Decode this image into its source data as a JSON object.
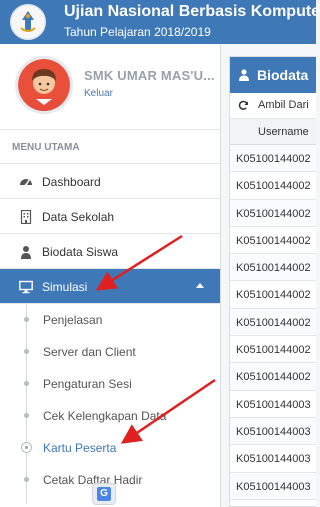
{
  "header": {
    "title": "Ujian Nasional Berbasis Komputer",
    "subtitle": "Tahun Pelajaran 2018/2019"
  },
  "profile": {
    "name": "SMK UMAR MAS'U...",
    "logout": "Keluar"
  },
  "menu": {
    "header": "MENU UTAMA",
    "items": [
      {
        "label": "Dashboard",
        "icon": "dashboard-icon"
      },
      {
        "label": "Data Sekolah",
        "icon": "building-icon"
      },
      {
        "label": "Biodata Siswa",
        "icon": "user-icon"
      },
      {
        "label": "Simulasi",
        "icon": "monitor-icon",
        "active": true
      }
    ],
    "submenu": [
      {
        "label": "Penjelasan"
      },
      {
        "label": "Server dan Client"
      },
      {
        "label": "Pengaturan Sesi"
      },
      {
        "label": "Cek Kelengkapan Data"
      },
      {
        "label": "Kartu Peserta",
        "current": true
      },
      {
        "label": "Cetak Daftar Hadir"
      }
    ]
  },
  "content": {
    "panel_title": "Biodata",
    "toolbar_label": "Ambil Dari",
    "column_header": "Username",
    "rows": [
      "K05100144002",
      "K05100144002",
      "K05100144002",
      "K05100144002",
      "K05100144002",
      "K05100144002",
      "K05100144002",
      "K05100144002",
      "K05100144002",
      "K05100144003",
      "K05100144003",
      "K05100144003",
      "K05100144003"
    ]
  },
  "colors": {
    "primary": "#3f78b7",
    "annotation_arrow": "#e02020"
  }
}
